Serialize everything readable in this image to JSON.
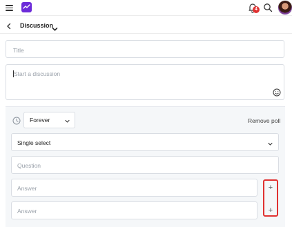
{
  "topbar": {
    "notification_count": "4",
    "icons": [
      "menu-icon",
      "app-logo-icon",
      "bell-icon",
      "search-icon",
      "avatar"
    ]
  },
  "header": {
    "title": "Discussion"
  },
  "composer": {
    "title_placeholder": "Title",
    "body_placeholder": "Start a discussion"
  },
  "poll": {
    "duration_value": "Forever",
    "remove_label": "Remove poll",
    "type_value": "Single select",
    "question_placeholder": "Question",
    "answers": [
      {
        "placeholder": "Answer"
      },
      {
        "placeholder": "Answer"
      }
    ],
    "add_symbol": "+"
  },
  "colors": {
    "brand": "#6c2bd9",
    "badge": "#e03131",
    "highlight_box": "#e03131",
    "poll_background": "#f5f7f9"
  }
}
